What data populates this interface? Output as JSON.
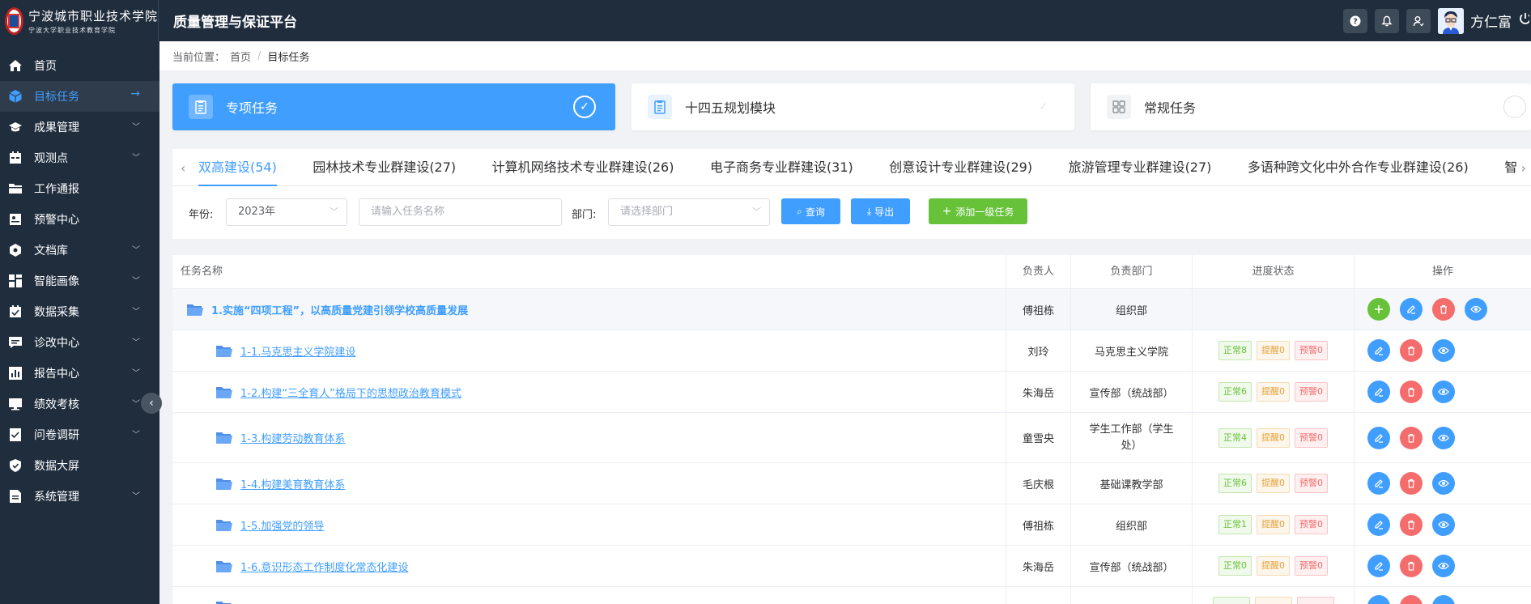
{
  "header": {
    "logo_line1": "宁波城市职业技术学院",
    "logo_line2": "宁波大学职业技术教育学院",
    "platform_title": "质量管理与保证平台",
    "username": "方仁富"
  },
  "sidebar": {
    "items": [
      {
        "label": "首页",
        "icon": "home-icon",
        "active": false,
        "has_children": false
      },
      {
        "label": "目标任务",
        "icon": "cube-icon",
        "active": true,
        "has_children": false
      },
      {
        "label": "成果管理",
        "icon": "graduation-cap-icon",
        "active": false,
        "has_children": true
      },
      {
        "label": "观测点",
        "icon": "calendar-icon",
        "active": false,
        "has_children": true
      },
      {
        "label": "工作通报",
        "icon": "folder-icon",
        "active": false,
        "has_children": false
      },
      {
        "label": "预警中心",
        "icon": "id-card-icon",
        "active": false,
        "has_children": false
      },
      {
        "label": "文档库",
        "icon": "hexagon-icon",
        "active": false,
        "has_children": true
      },
      {
        "label": "智能画像",
        "icon": "grid-icon",
        "active": false,
        "has_children": true
      },
      {
        "label": "数据采集",
        "icon": "calendar-check-icon",
        "active": false,
        "has_children": true
      },
      {
        "label": "诊改中心",
        "icon": "message-icon",
        "active": false,
        "has_children": true
      },
      {
        "label": "报告中心",
        "icon": "bar-chart-icon",
        "active": false,
        "has_children": true
      },
      {
        "label": "绩效考核",
        "icon": "monitor-icon",
        "active": false,
        "has_children": true
      },
      {
        "label": "问卷调研",
        "icon": "checklist-icon",
        "active": false,
        "has_children": true
      },
      {
        "label": "数据大屏",
        "icon": "shield-icon",
        "active": false,
        "has_children": false
      },
      {
        "label": "系统管理",
        "icon": "document-icon",
        "active": false,
        "has_children": true
      }
    ]
  },
  "breadcrumb": {
    "prefix": "当前位置：",
    "home": "首页",
    "separator": "/",
    "current": "目标任务"
  },
  "cards": [
    {
      "label": "专项任务",
      "active": true
    },
    {
      "label": "十四五规划模块",
      "active": false
    },
    {
      "label": "常规任务",
      "active": false
    }
  ],
  "tabs": [
    {
      "label": "双高建设(54)",
      "active": true
    },
    {
      "label": "园林技术专业群建设(27)",
      "active": false
    },
    {
      "label": "计算机网络技术专业群建设(26)",
      "active": false
    },
    {
      "label": "电子商务专业群建设(31)",
      "active": false
    },
    {
      "label": "创意设计专业群建设(29)",
      "active": false
    },
    {
      "label": "旅游管理专业群建设(27)",
      "active": false
    },
    {
      "label": "多语种跨文化中外合作专业群建设(26)",
      "active": false
    },
    {
      "label": "智能财金专业群建设",
      "active": false
    }
  ],
  "filters": {
    "year_label": "年份:",
    "year_value": "2023年",
    "task_placeholder": "请输入任务名称",
    "dept_label": "部门:",
    "dept_placeholder": "请选择部门",
    "query_label": "查询",
    "export_label": "导出",
    "add_label": "添加一级任务"
  },
  "table": {
    "columns": [
      "任务名称",
      "负责人",
      "负责部门",
      "进度状态",
      "操作"
    ],
    "rows": [
      {
        "name": "1.实施“四项工程”，以高质量党建引领学校高质量发展",
        "owner": "傅祖栋",
        "dept": "组织部",
        "parent": true
      },
      {
        "name": "1-1.马克思主义学院建设",
        "owner": "刘玲",
        "dept": "马克思主义学院",
        "ok": "正常8",
        "warn": "提醒0",
        "alarm": "预警0"
      },
      {
        "name": "1-2.构建“三全育人”格局下的思想政治教育模式",
        "owner": "朱海岳",
        "dept": "宣传部（统战部）",
        "ok": "正常6",
        "warn": "提醒0",
        "alarm": "预警0"
      },
      {
        "name": "1-3.构建劳动教育体系",
        "owner": "童雪央",
        "dept": "学生工作部（学生处）",
        "ok": "正常4",
        "warn": "提醒0",
        "alarm": "预警0"
      },
      {
        "name": "1-4.构建美育教育体系",
        "owner": "毛庆根",
        "dept": "基础课教学部",
        "ok": "正常6",
        "warn": "提醒0",
        "alarm": "预警0"
      },
      {
        "name": "1-5.加强党的领导",
        "owner": "傅祖栋",
        "dept": "组织部",
        "ok": "正常1",
        "warn": "提醒0",
        "alarm": "预警0"
      },
      {
        "name": "1-6.意识形态工作制度化常态化建设",
        "owner": "朱海岳",
        "dept": "宣传部（统战部）",
        "ok": "正常0",
        "warn": "提醒0",
        "alarm": "预警0"
      },
      {
        "name": "",
        "owner": "",
        "dept": "",
        "ok": "",
        "warn": "",
        "alarm": "",
        "partial": true
      }
    ]
  },
  "colors": {
    "primary": "#409eff",
    "header_bg": "#1f2d3d",
    "success": "#67c23a",
    "danger": "#f56c6c",
    "warning": "#e6a23c"
  }
}
